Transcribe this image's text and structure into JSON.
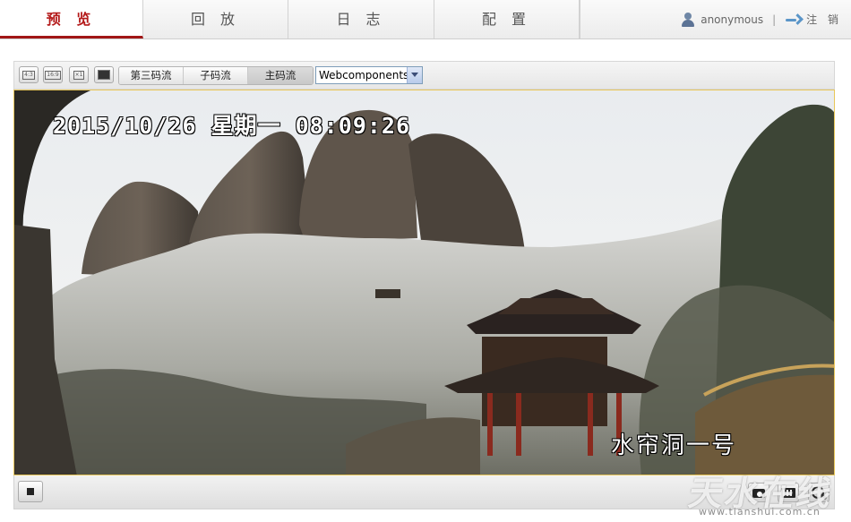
{
  "nav": {
    "tabs": [
      {
        "label": "预 览",
        "active": true
      },
      {
        "label": "回 放",
        "active": false
      },
      {
        "label": "日 志",
        "active": false
      },
      {
        "label": "配 置",
        "active": false
      }
    ],
    "user": "anonymous",
    "separator": "|",
    "logout": "注 销"
  },
  "toolbar": {
    "aspect_buttons": [
      "4:3",
      "16:9",
      "×1"
    ],
    "streams": [
      "第三码流",
      "子码流",
      "主码流"
    ],
    "active_stream": "主码流",
    "plugin": "Webcomponents"
  },
  "video": {
    "osd_time": "2015/10/26 星期一 08:09:26",
    "osd_name": "水帘洞一号"
  },
  "watermark": {
    "text": "天水在线",
    "url": "www.tianshui.com.cn"
  },
  "colors": {
    "active_tab": "#b41a1a",
    "video_border": "#e8c75a"
  }
}
